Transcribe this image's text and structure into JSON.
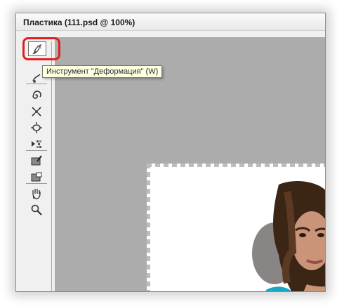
{
  "window": {
    "title": "Пластика (111.psd @ 100%)"
  },
  "tooltip": {
    "text": "Инструмент \"Деформация\" (W)"
  },
  "tools": [
    {
      "name": "forward-warp-tool",
      "selected": true
    },
    {
      "name": "reconstruct-tool"
    },
    {
      "name": "twirl-clockwise-tool"
    },
    {
      "name": "pucker-tool"
    },
    {
      "name": "bloat-tool"
    },
    {
      "name": "push-left-tool"
    },
    {
      "name": "freeze-mask-tool"
    },
    {
      "name": "thaw-mask-tool"
    },
    {
      "name": "hand-tool"
    },
    {
      "name": "zoom-tool"
    }
  ],
  "colors": {
    "canvas": "#acacac",
    "highlight": "#e02020",
    "tooltip_bg": "#ffffe1"
  }
}
